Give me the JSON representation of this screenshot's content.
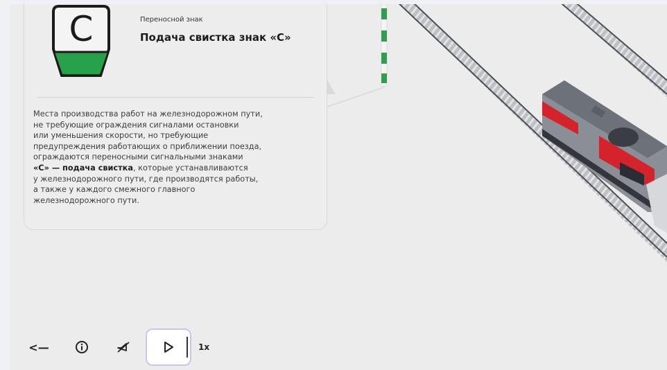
{
  "card": {
    "sign_letter": "С",
    "subtitle": "Переносной знак",
    "title": "Подача свистка знак «С»",
    "text_lines": [
      "Места производства работ на железнодорожном пути,",
      "не требующие ограждения сигналами остановки",
      "или уменьшения скорости, но требующие",
      "предупреждения работающих о приближении поезда,",
      "ограждаются переносными сигнальными знаками"
    ],
    "text_bold": "«С» — подача свистка",
    "text_after_bold": ", которые устанавливаются",
    "text_tail_lines": [
      "у железнодорожного пути, где производятся работы,",
      "а также у каждого смежного главного",
      "железнодорожного пути."
    ]
  },
  "toolbar": {
    "back_icon": "<—",
    "info_icon": "info-icon",
    "sound_icon": "sound-off-icon",
    "play_icon": "play-icon",
    "speed": "1x"
  },
  "colors": {
    "sign_green": "#27a04a",
    "pole_green": "#2f9e4f",
    "train_red": "#d4232b",
    "train_gray": "#8a8f96",
    "play_border": "#c9c5ee"
  }
}
